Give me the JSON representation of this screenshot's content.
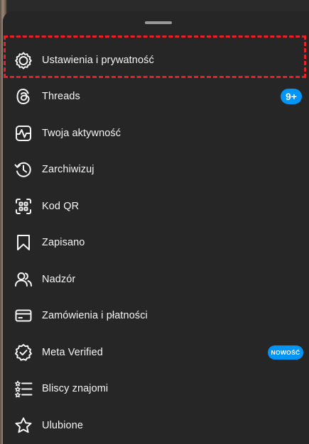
{
  "menu": {
    "items": [
      {
        "label": "Ustawienia i prywatność",
        "icon": "settings-icon"
      },
      {
        "label": "Threads",
        "icon": "threads-icon",
        "badge": "9+"
      },
      {
        "label": "Twoja aktywność",
        "icon": "activity-icon"
      },
      {
        "label": "Zarchiwizuj",
        "icon": "archive-icon"
      },
      {
        "label": "Kod QR",
        "icon": "qr-code-icon"
      },
      {
        "label": "Zapisano",
        "icon": "bookmark-icon"
      },
      {
        "label": "Nadzór",
        "icon": "supervision-icon"
      },
      {
        "label": "Zamówienia i płatności",
        "icon": "card-icon"
      },
      {
        "label": "Meta Verified",
        "icon": "verified-badge-icon",
        "badge": "NOWOŚĆ"
      },
      {
        "label": "Bliscy znajomi",
        "icon": "close-friends-icon"
      },
      {
        "label": "Ulubione",
        "icon": "star-icon"
      }
    ]
  },
  "colors": {
    "sheet_background": "#262626",
    "text": "#f5f5f5",
    "badge": "#0095f6",
    "highlight": "#e8202a"
  }
}
